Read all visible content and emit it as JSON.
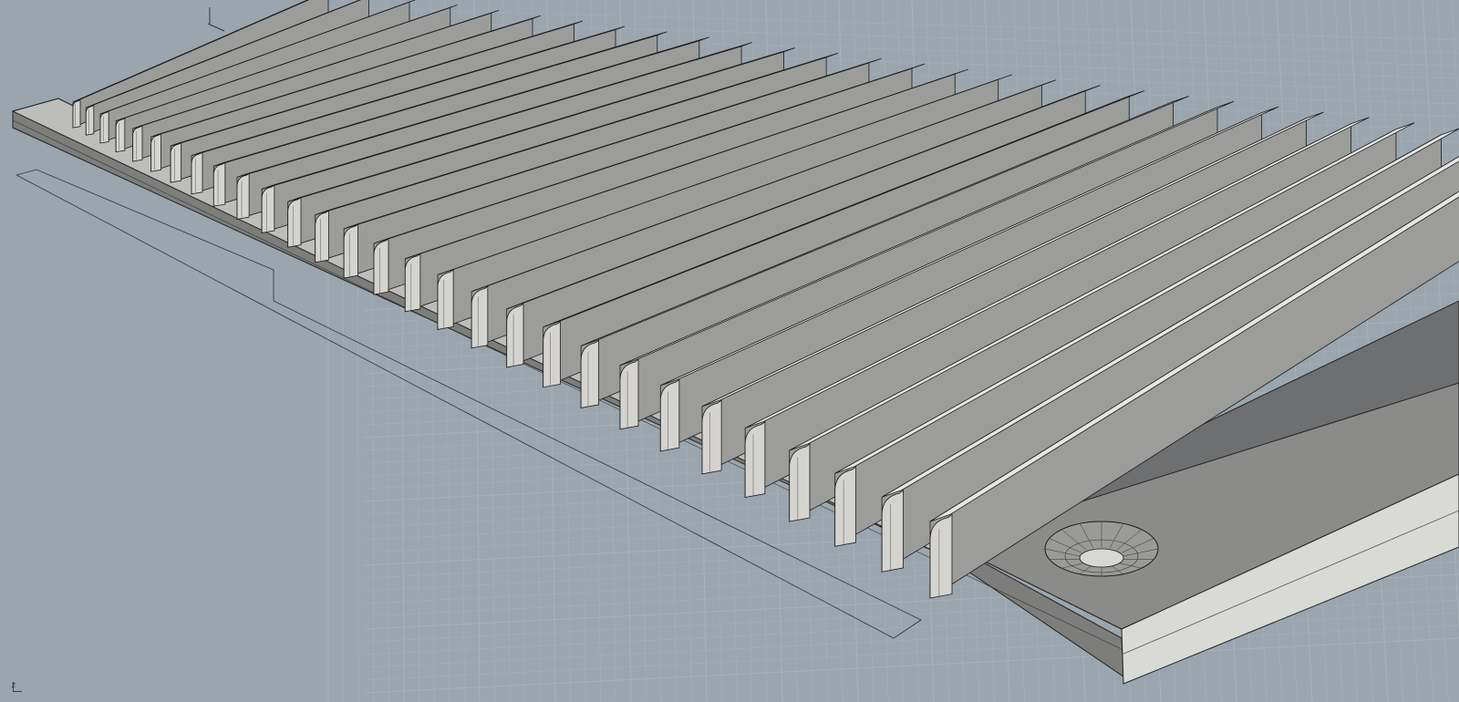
{
  "viewport": {
    "background_color": "#9ba5ae",
    "grid_color": "#a9b1b8",
    "axis_label": "z"
  },
  "model": {
    "plate_top_color": "#bdbdbb",
    "plate_edge_color": "#7d7d7c",
    "plate_front_color": "#d9d9d6",
    "recess_floor_color": "#6e6f70",
    "fin_top_color": "#e6e5e1",
    "fin_side_color": "#9c9c9a",
    "fin_count": 29,
    "hole_count": 1
  }
}
